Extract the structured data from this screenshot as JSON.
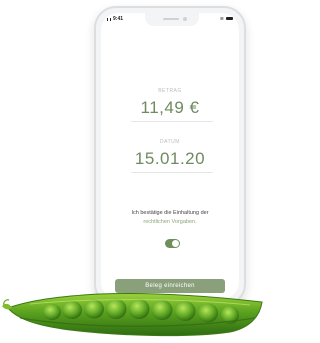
{
  "status_bar": {
    "time": "9:41"
  },
  "amount": {
    "label": "BETRAG",
    "value": "11,49 €"
  },
  "date": {
    "label": "DATUM",
    "value": "15.01.20"
  },
  "consent": {
    "text": "Ich bestätige die Einhaltung der",
    "link": "rechtlichen Vorgaben.",
    "toggle_on": true
  },
  "submit_button": {
    "label": "Beleg einreichen"
  },
  "colors": {
    "accent": "#6f8a60",
    "button": "#89a07b",
    "toggle": "#6f8f5a",
    "pod_green": "#4f8f1e"
  }
}
